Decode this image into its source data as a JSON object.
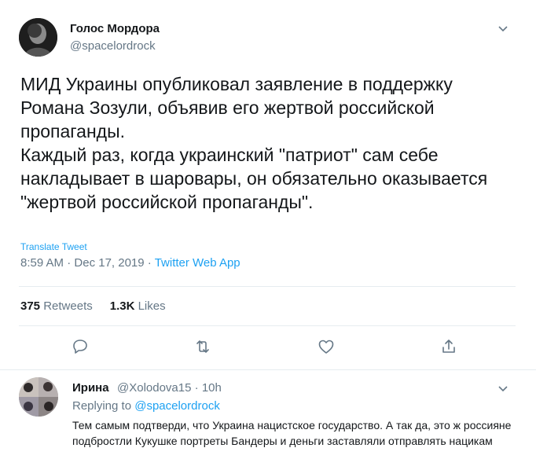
{
  "tweet": {
    "author_name": "Голос Мордора",
    "author_handle": "@spacelordrock",
    "text": "МИД Украины опубликовал заявление в поддержку Романа Зозули, объявив его жертвой российской пропаганды.\nКаждый раз, когда украинский \"патриот\" сам себе накладывает в шаровары, он обязательно оказывается \"жертвой российской пропаганды\".",
    "translate_label": "Translate Tweet",
    "time": "8:59 AM",
    "date": "Dec 17, 2019",
    "app": "Twitter Web App",
    "separator": "·",
    "retweets_count": "375",
    "retweets_label": "Retweets",
    "likes_count": "1.3K",
    "likes_label": "Likes"
  },
  "actions": {
    "icons": [
      "reply-icon",
      "retweet-icon",
      "like-icon",
      "share-icon"
    ]
  },
  "reply": {
    "author_name": "Ирина",
    "author_handle": "@Xolodova15",
    "separator": "·",
    "time": "10h",
    "replying_prefix": "Replying to",
    "replying_to": "@spacelordrock",
    "text": "Тем самым подтверди, что Украина нацистское государство. А так да, это ж россияне подбростли Кукушке портреты Бандеры и деньги заставляли отправлять нацикам"
  },
  "colors": {
    "accent": "#1da1f2",
    "secondary_text": "#657786",
    "primary_text": "#14171a",
    "divider": "#e6ecf0"
  }
}
